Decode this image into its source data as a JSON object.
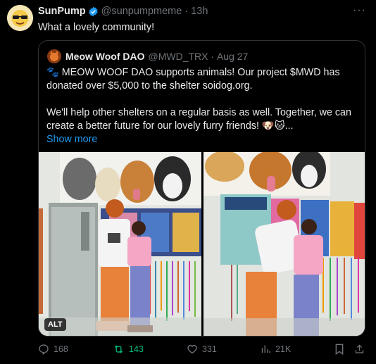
{
  "tweet": {
    "author_name": "SunPump",
    "author_handle": "@sunpumpmeme",
    "time": "13h",
    "text": "What a lovely community!"
  },
  "quote": {
    "author_name": "Meow Woof DAO",
    "author_handle": "@MWD_TRX",
    "date": "Aug 27",
    "line1": "🐾 MEOW WOOF DAO supports animals! Our project $MWD has donated over $5,000 to the shelter soidog.org.",
    "line2": "We'll help other shelters on a regular basis as well. Together, we can create a better future for our lovely furry friends! 🐶🐱...",
    "show_more": "Show more",
    "alt_badge": "ALT"
  },
  "actions": {
    "replies": "168",
    "retweets": "143",
    "likes": "331",
    "views": "21K"
  },
  "colors": {
    "background": "#000000",
    "text": "#e7e9ea",
    "muted": "#71767b",
    "link": "#1d9bf0",
    "retweet_active": "#00ba7c",
    "border": "#2f3336"
  }
}
